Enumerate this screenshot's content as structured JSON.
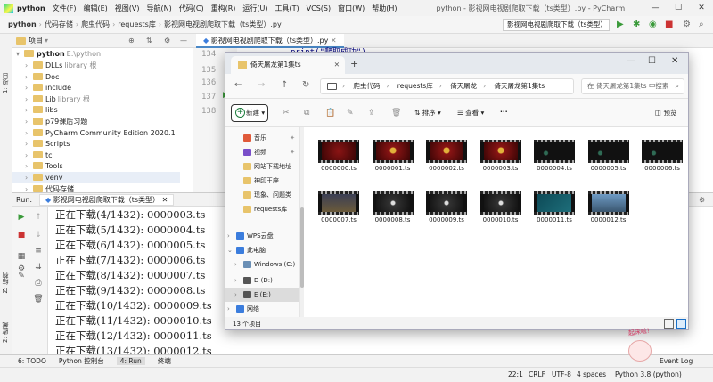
{
  "menubar": {
    "logo": "python",
    "items": [
      "文件(F)",
      "编辑(E)",
      "视图(V)",
      "导航(N)",
      "代码(C)",
      "重构(R)",
      "运行(U)",
      "工具(T)",
      "VCS(S)",
      "窗口(W)",
      "帮助(H)"
    ],
    "window_title": "python - 影视网电视剧爬取下载（ts类型）.py - PyCharm",
    "minimize": "—",
    "maximize": "☐",
    "close": "✕"
  },
  "navbar": {
    "crumbs": [
      "python",
      "代码存储",
      "爬虫代码",
      "requests库",
      "影视网电视剧爬取下载（ts类型）.py"
    ],
    "run_config": "影视网电视剧爬取下载（ts类型）"
  },
  "left_tools": {
    "project": "1: 项目",
    "structure": "Z: 结构",
    "favorites": "2: 收藏"
  },
  "project": {
    "header": "项目",
    "root": {
      "name": "python",
      "path": "E:\\python"
    },
    "items": [
      {
        "name": "DLLs",
        "note": "library 根"
      },
      {
        "name": "Doc",
        "note": ""
      },
      {
        "name": "include",
        "note": ""
      },
      {
        "name": "Lib",
        "note": "library 根"
      },
      {
        "name": "libs",
        "note": ""
      },
      {
        "name": "p79课后习题",
        "note": ""
      },
      {
        "name": "PyCharm Community Edition 2020.1",
        "note": ""
      },
      {
        "name": "Scripts",
        "note": ""
      },
      {
        "name": "tcl",
        "note": ""
      },
      {
        "name": "Tools",
        "note": ""
      },
      {
        "name": "venv",
        "note": ""
      },
      {
        "name": "代码存储",
        "note": ""
      }
    ]
  },
  "editor": {
    "tab": "影视网电视剧爬取下载（ts类型）.py",
    "lines": [
      "134",
      "135",
      "136",
      "137",
      "138"
    ],
    "code_visible": "print(\"爬取成功\")"
  },
  "run": {
    "label": "Run:",
    "config": "影视网电视剧爬取下载（ts类型）",
    "console": [
      "正在下载(4/1432): 0000003.ts",
      "正在下载(5/1432): 0000004.ts",
      "正在下载(6/1432): 0000005.ts",
      "正在下载(7/1432): 0000006.ts",
      "正在下载(8/1432): 0000007.ts",
      "正在下载(9/1432): 0000008.ts",
      "正在下载(10/1432): 0000009.ts",
      "正在下载(11/1432): 0000010.ts",
      "正在下载(12/1432): 0000011.ts",
      "正在下载(13/1432): 0000012.ts"
    ]
  },
  "bottom_tabs": [
    "6: TODO",
    "Python 控制台",
    "4: Run",
    "终端"
  ],
  "statusbar": {
    "position": "22:1",
    "line_sep": "CRLF",
    "encoding": "UTF-8",
    "indent": "4 spaces",
    "interpreter": "Python 3.8 (python)",
    "event_log": "Event Log"
  },
  "explorer": {
    "tab_title": "倚天屠龙第1集ts",
    "tab_close": "✕",
    "new_tab": "+",
    "address": [
      "爬虫代码",
      "requests库",
      "倚天屠龙",
      "倚天屠龙第1集ts"
    ],
    "search_placeholder": "在 倚天屠龙第1集ts 中搜索",
    "toolbar": {
      "new": "新建",
      "sort": "排序",
      "view": "查看",
      "more": "···",
      "preview": "预览"
    },
    "nav": [
      {
        "label": "音乐",
        "color": "#e05a3a",
        "pin": true
      },
      {
        "label": "视频",
        "color": "#7a4fc9",
        "pin": true
      },
      {
        "label": "网站下载地址",
        "color": "#e8c46b",
        "pin": false
      },
      {
        "label": "神印王座",
        "color": "#e8c46b",
        "pin": false
      },
      {
        "label": "现象、问题类",
        "color": "#e8c46b",
        "pin": false
      },
      {
        "label": "requests库",
        "color": "#e8c46b",
        "pin": false
      },
      {
        "label": "WPS云盘",
        "color": "#3b7ddd",
        "pin": false
      },
      {
        "label": "此电脑",
        "color": "#3b7ddd",
        "pin": false
      },
      {
        "label": "Windows (C:)",
        "color": "#6a8fb5",
        "pin": false
      },
      {
        "label": "D (D:)",
        "color": "#555555",
        "pin": false
      },
      {
        "label": "E (E:)",
        "color": "#555555",
        "pin": false
      },
      {
        "label": "网络",
        "color": "#3b7ddd",
        "pin": false
      }
    ],
    "files": [
      {
        "name": "0000000.ts",
        "tone": "red"
      },
      {
        "name": "0000001.ts",
        "tone": "redlogo"
      },
      {
        "name": "0000002.ts",
        "tone": "redlogo"
      },
      {
        "name": "0000003.ts",
        "tone": "redlogo"
      },
      {
        "name": "0000004.ts",
        "tone": "dark"
      },
      {
        "name": "0000005.ts",
        "tone": "dark"
      },
      {
        "name": "0000006.ts",
        "tone": "dark"
      },
      {
        "name": "0000007.ts",
        "tone": "night"
      },
      {
        "name": "0000008.ts",
        "tone": "title"
      },
      {
        "name": "0000009.ts",
        "tone": "title"
      },
      {
        "name": "0000010.ts",
        "tone": "title"
      },
      {
        "name": "0000011.ts",
        "tone": "teal"
      },
      {
        "name": "0000012.ts",
        "tone": "city"
      }
    ],
    "status": "13 个项目"
  },
  "sticker_text": "起床啦!"
}
